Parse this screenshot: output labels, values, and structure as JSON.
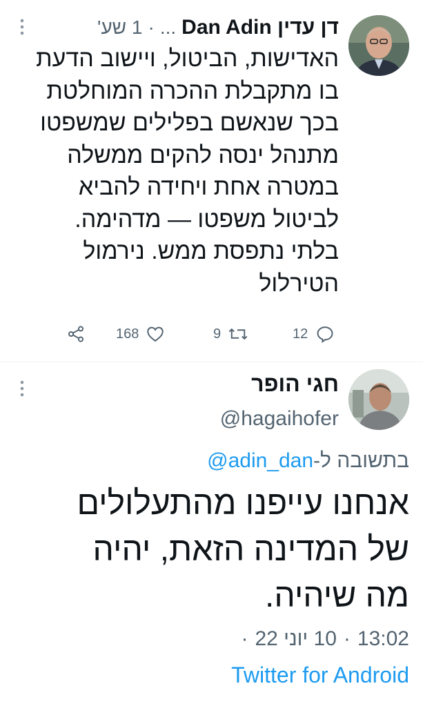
{
  "tweet1": {
    "name": "דן עדין Dan Adin",
    "handle": "...",
    "separator": "·",
    "time": "1 שע'",
    "body_lines": [
      "האדישות, הביטול, ויישוב הדעת",
      "בו מתקבלת ההכרה המוחלטת",
      "בכך שנאשם בפלילים שמשפטו",
      "מתנהל ינסה להקים ממשלה",
      "במטרה אחת ויחידה להביא",
      "לביטול משפטו — מדהימה.",
      "בלתי נתפסת ממש. נירמול",
      "הטירלול"
    ],
    "actions": {
      "reply_count": "12",
      "retweet_count": "9",
      "like_count": "168"
    },
    "icons": {
      "reply": "reply-icon",
      "retweet": "retweet-icon",
      "like": "like-icon",
      "share": "share-icon",
      "more": "more-icon"
    }
  },
  "tweet2": {
    "name": "חגי הופר",
    "handle": "@hagaihofer",
    "reply_prefix": "בתשובה ל-",
    "reply_mention": "@adin_dan",
    "body_lines": [
      "אנחנו עייפנו מהתעלולים",
      "של המדינה הזאת, יהיה",
      "מה שיהיה."
    ],
    "time": "13:02",
    "date": "10 יוני 22",
    "meta_separator": "·",
    "source": "Twitter for Android"
  },
  "colors": {
    "text": "#0f1419",
    "secondary": "#536471",
    "link": "#1d9bf0",
    "divider": "#eff3f4"
  }
}
